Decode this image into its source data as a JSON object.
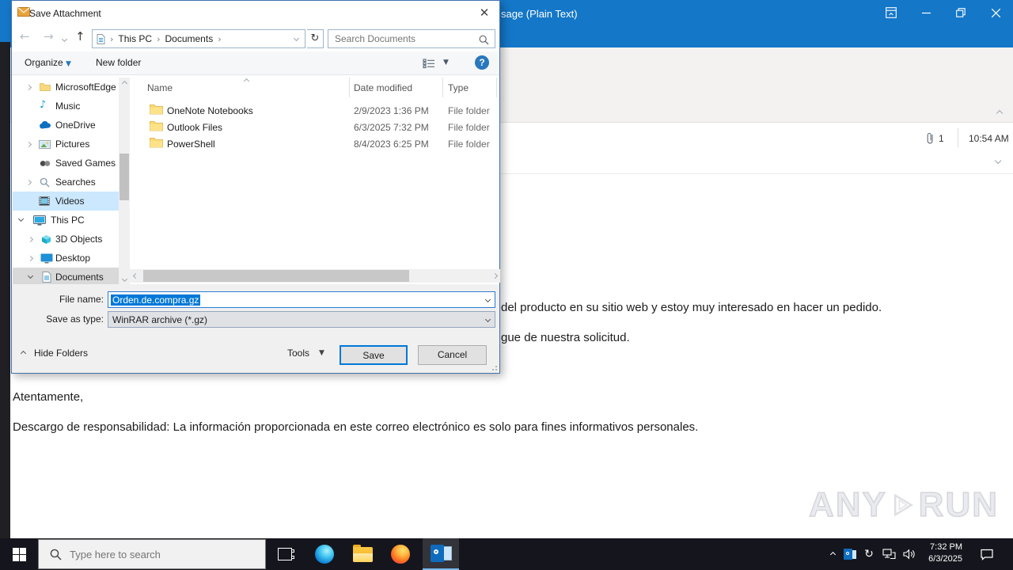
{
  "colors": {
    "accent": "#0078d7",
    "titlebar_blue": "#1477c8",
    "selection_blue": "#cbe8ff",
    "folder_yellow": "#ffd968",
    "taskbar_bg": "#15151d"
  },
  "dialog": {
    "title": "Save Attachment",
    "nav": {
      "breadcrumb_root": "This PC",
      "breadcrumb_child": "Documents",
      "search_placeholder": "Search Documents"
    },
    "toolbar": {
      "organize": "Organize",
      "new_folder": "New folder"
    },
    "sidebar": [
      {
        "label": "MicrosoftEdge"
      },
      {
        "label": "Music"
      },
      {
        "label": "OneDrive"
      },
      {
        "label": "Pictures"
      },
      {
        "label": "Saved Games"
      },
      {
        "label": "Searches"
      },
      {
        "label": "Videos"
      },
      {
        "label": "This PC"
      },
      {
        "label": "3D Objects"
      },
      {
        "label": "Desktop"
      },
      {
        "label": "Documents"
      }
    ],
    "files": {
      "columns": [
        "Name",
        "Date modified",
        "Type"
      ],
      "rows": [
        {
          "name": "OneNote Notebooks",
          "date": "2/9/2023 1:36 PM",
          "type": "File folder"
        },
        {
          "name": "Outlook Files",
          "date": "6/3/2025 7:32 PM",
          "type": "File folder"
        },
        {
          "name": "PowerShell",
          "date": "8/4/2023 6:25 PM",
          "type": "File folder"
        }
      ]
    },
    "file_name_label": "File name:",
    "file_name_value": "Orden.de.compra.gz",
    "save_type_label": "Save as type:",
    "save_type_value": "WinRAR archive (*.gz)",
    "footer": {
      "hide_folders": "Hide Folders",
      "tools": "Tools",
      "save": "Save",
      "cancel": "Cancel"
    }
  },
  "outlook": {
    "title_fragment": "sage (Plain Text)",
    "attachment_count": "1",
    "received_time": "10:54 AM",
    "body_line_1": "del producto en su sitio web y estoy muy interesado en hacer un pedido.",
    "body_line_2": "gue de nuestra solicitud.",
    "body_line_3": "Atentamente,",
    "body_line_4": "Descargo de responsabilidad: La información proporcionada en este correo electrónico es solo para fines informativos personales."
  },
  "taskbar": {
    "search_placeholder": "Type here to search",
    "time": "7:32 PM",
    "date": "6/3/2025"
  },
  "watermark": {
    "left": "ANY",
    "right": "RUN"
  }
}
